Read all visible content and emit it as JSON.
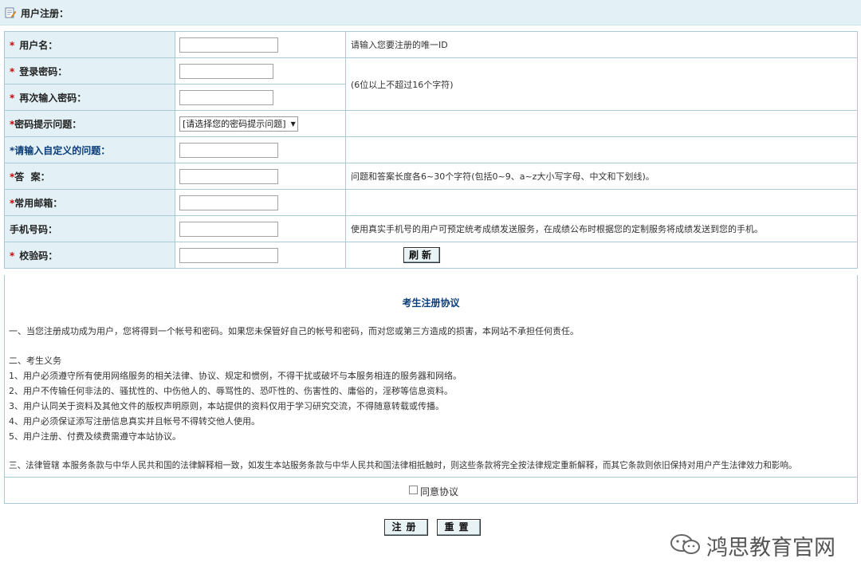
{
  "header": {
    "title": "用户注册："
  },
  "form": {
    "username_label": "用户名：",
    "username_tip": "请输入您要注册的唯一ID",
    "password_label": "登录密码：",
    "password_tip": "(6位以上不超过16个字符)",
    "password_confirm_label": "再次输入密码：",
    "hint_question_label": "密码提示问题：",
    "hint_question_selected": "[请选择您的密码提示问题]",
    "custom_question_label": "请输入自定义的问题：",
    "answer_label": "答  案：",
    "answer_tip": "问题和答案长度各6~30个字符(包括0~9、a~z大小写字母、中文和下划线)。",
    "email_label": "常用邮箱：",
    "phone_label": "手机号码：",
    "phone_tip": "使用真实手机号的用户可预定统考成绩发送服务，在成绩公布时根据您的定制服务将成绩发送到您的手机。",
    "captcha_label": "校验码：",
    "refresh_label": "刷新",
    "required_mark": "*"
  },
  "agreement": {
    "title": "考生注册协议",
    "lines": [
      "一、当您注册成功成为用户，您将得到一个帐号和密码。如果您未保管好自己的帐号和密码，而对您或第三方造成的损害，本网站不承担任何责任。",
      "二、考生义务",
      "1、用户必须遵守所有使用网络服务的相关法律、协议、规定和惯例，不得干扰或破坏与本服务相连的服务器和网络。",
      "2、用户不传输任何非法的、骚扰性的、中伤他人的、辱骂性的、恐吓性的、伤害性的、庸俗的，淫秽等信息资料。",
      "3、用户认同关于资料及其他文件的版权声明原则，本站提供的资料仅用于学习研究交流，不得随意转载或传播。",
      "4、用户必须保证添写注册信息真实并且帐号不得转交他人使用。",
      "5、用户注册、付费及续费需遵守本站协议。",
      "三、法律管辖 本服务条款与中华人民共和国的法律解释相一致，如发生本站服务条款与中华人民共和国法律相抵触时，则这些条款将完全按法律规定重新解释，而其它条款则依旧保持对用户产生法律效力和影响。"
    ],
    "agree_label": "同意协议"
  },
  "buttons": {
    "submit": "注册",
    "reset": "重置"
  },
  "watermark": {
    "text": "鸿思教育官网"
  }
}
